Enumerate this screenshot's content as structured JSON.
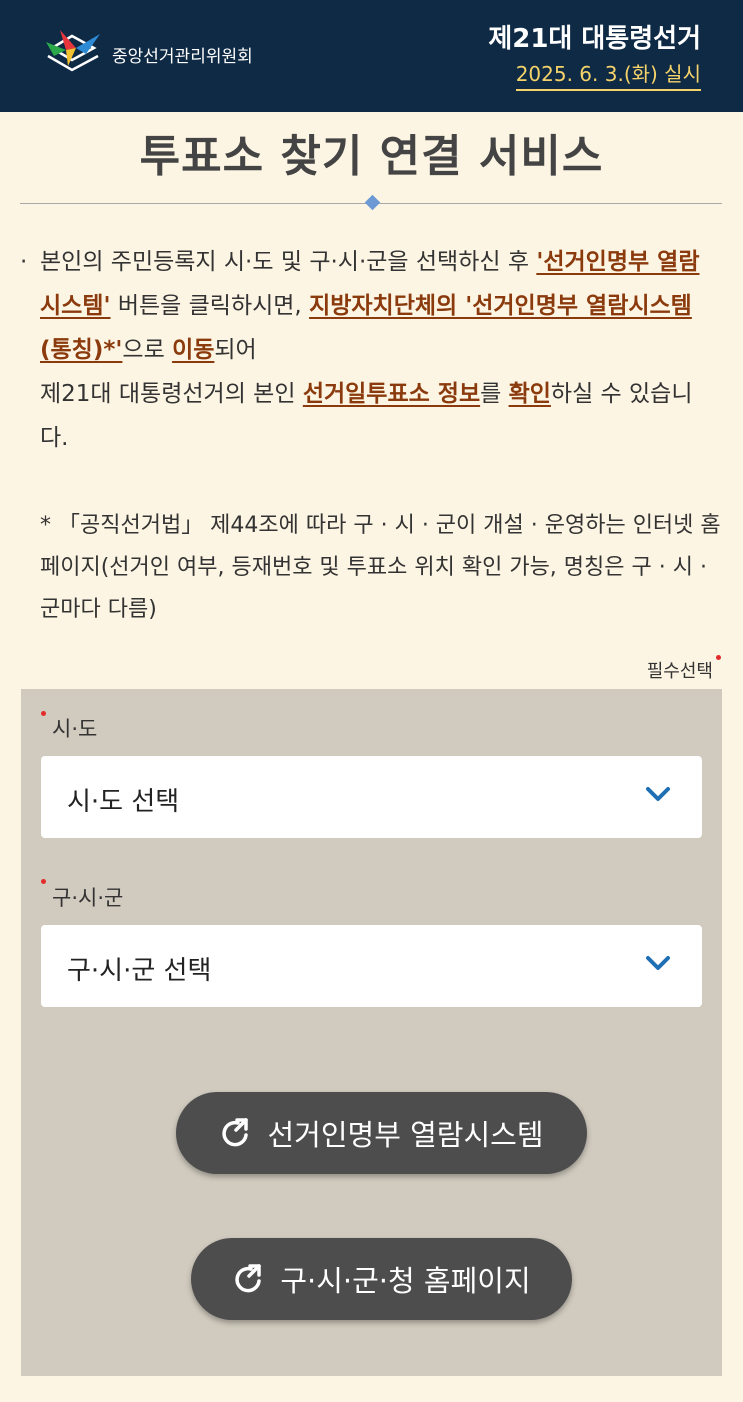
{
  "header": {
    "org_name": "중앙선거관리위원회",
    "title": "제21대 대통령선거",
    "date": "2025. 6. 3.(화) 실시"
  },
  "page_title": "투표소 찾기 연결 서비스",
  "description": {
    "bullet": "·",
    "t1": "본인의 주민등록지 시·도 및 구·시·군을 선택하신 후 ",
    "h1": "'선거인명부 열람시스템'",
    "t2": " 버튼을 클릭하시면, ",
    "h2": "지방자치단체의 '선거인명부 열람시스템(통칭)*'",
    "t3": "으로 ",
    "h3": "이동",
    "t4": "되어",
    "t5": "제21대 대통령선거의 본인 ",
    "h4": "선거일투표소 정보",
    "t6": "를 ",
    "h5": "확인",
    "t7": "하실 수 있습니다."
  },
  "note": "* 「공직선거법」 제44조에 따라 구 · 시 · 군이 개설 · 운영하는 인터넷 홈페이지(선거인 여부, 등재번호 및 투표소 위치 확인 가능, 명칭은 구 · 시 · 군마다 다름)",
  "required_hint": "필수선택",
  "form": {
    "sido": {
      "label": "시·도",
      "placeholder": "시·도 선택"
    },
    "sigungu": {
      "label": "구·시·군",
      "placeholder": "구·시·군 선택"
    }
  },
  "buttons": {
    "registry": "선거인명부 열람시스템",
    "homepage": "구·시·군·청 홈페이지"
  },
  "icons": {
    "logo": "nec-logo-icon",
    "chevron": "chevron-down-icon",
    "link": "external-link-icon"
  },
  "colors": {
    "header_bg": "#0f2a45",
    "accent_date": "#f5d36a",
    "highlight": "#8a3a0c",
    "required_dot": "#e32b2b",
    "chevron": "#1f6fb5",
    "button_bg": "#4d4d4d"
  }
}
